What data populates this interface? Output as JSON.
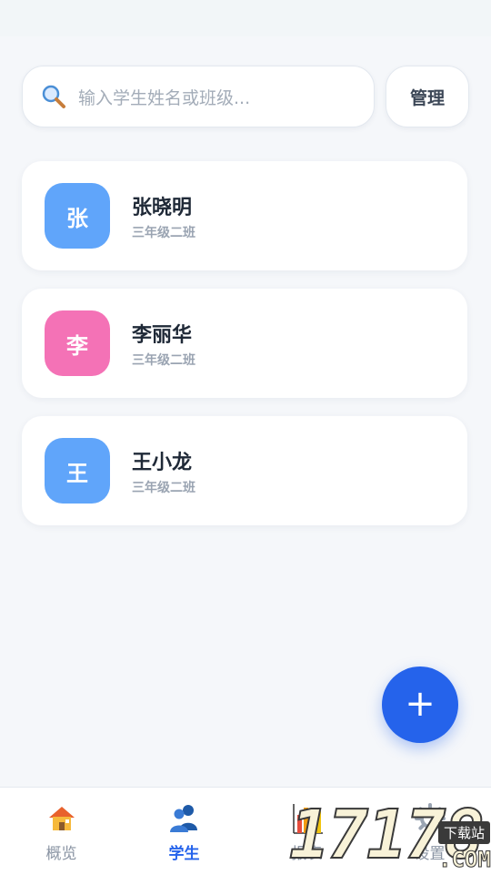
{
  "search": {
    "placeholder": "输入学生姓名或班级...",
    "manage_label": "管理"
  },
  "students": [
    {
      "avatar_char": "张",
      "name": "张晓明",
      "class": "三年级二班",
      "avatar_color": "#60a5fa"
    },
    {
      "avatar_char": "李",
      "name": "李丽华",
      "class": "三年级二班",
      "avatar_color": "#f472b6"
    },
    {
      "avatar_char": "王",
      "name": "王小龙",
      "class": "三年级二班",
      "avatar_color": "#60a5fa"
    }
  ],
  "fab": {
    "label": "+"
  },
  "nav": [
    {
      "label": "概览",
      "icon": "house-icon",
      "active": false
    },
    {
      "label": "学生",
      "icon": "users-icon",
      "active": true
    },
    {
      "label": "报表",
      "icon": "bar-chart-icon",
      "active": false
    },
    {
      "label": "设置",
      "icon": "gear-icon",
      "active": false
    }
  ],
  "watermark": {
    "number": "17178",
    "domain": ".COM",
    "site": "下载站"
  },
  "colors": {
    "accent": "#2563eb",
    "background": "#f5f7fa"
  }
}
